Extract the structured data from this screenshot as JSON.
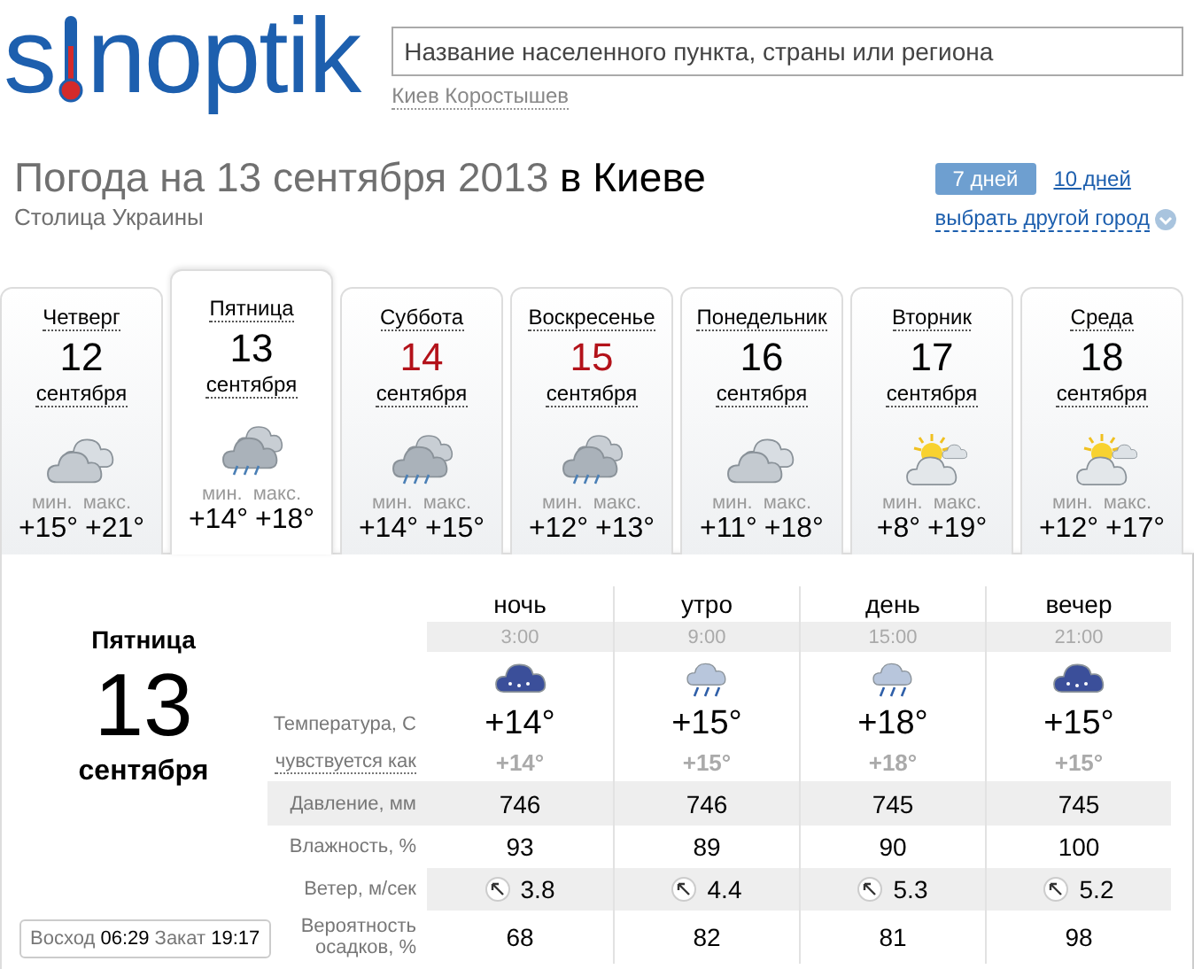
{
  "logo": {
    "part1": "s",
    "part2": "noptik"
  },
  "search": {
    "placeholder": "Название населенного пункта, страны или региона"
  },
  "suggestion": "Киев Коростышев",
  "heading": {
    "date_part": "Погода на 13 сентября 2013",
    "city_part": "в Киеве",
    "subtitle": "Столица Украины"
  },
  "range_tabs": [
    {
      "label": "7 дней",
      "selected": true
    },
    {
      "label": "10 дней",
      "selected": false
    }
  ],
  "choose_city": "выбрать другой город",
  "days": [
    {
      "weekday": "Четверг",
      "date": "12",
      "month": "сентября",
      "weekend": false,
      "selected": false,
      "kind": "cloudy",
      "min_label": "мин.",
      "max_label": "макс.",
      "min": "+15°",
      "max": "+21°"
    },
    {
      "weekday": "Пятница",
      "date": "13",
      "month": "сентября",
      "weekend": false,
      "selected": true,
      "kind": "rain",
      "min_label": "мин.",
      "max_label": "макс.",
      "min": "+14°",
      "max": "+18°"
    },
    {
      "weekday": "Суббота",
      "date": "14",
      "month": "сентября",
      "weekend": true,
      "selected": false,
      "kind": "rain",
      "min_label": "мин.",
      "max_label": "макс.",
      "min": "+14°",
      "max": "+15°"
    },
    {
      "weekday": "Воскресенье",
      "date": "15",
      "month": "сентября",
      "weekend": true,
      "selected": false,
      "kind": "rain",
      "min_label": "мин.",
      "max_label": "макс.",
      "min": "+12°",
      "max": "+13°"
    },
    {
      "weekday": "Понедельник",
      "date": "16",
      "month": "сентября",
      "weekend": false,
      "selected": false,
      "kind": "cloudy",
      "min_label": "мин.",
      "max_label": "макс.",
      "min": "+11°",
      "max": "+18°"
    },
    {
      "weekday": "Вторник",
      "date": "17",
      "month": "сентября",
      "weekend": false,
      "selected": false,
      "kind": "partly-sunny",
      "min_label": "мин.",
      "max_label": "макс.",
      "min": "+8°",
      "max": "+19°"
    },
    {
      "weekday": "Среда",
      "date": "18",
      "month": "сентября",
      "weekend": false,
      "selected": false,
      "kind": "partly-sunny",
      "min_label": "мин.",
      "max_label": "макс.",
      "min": "+12°",
      "max": "+17°"
    }
  ],
  "detail": {
    "weekday": "Пятница",
    "date": "13",
    "month": "сентября",
    "sunrise_label": "Восход",
    "sunrise": "06:29",
    "sunset_label": "Закат",
    "sunset": "19:17",
    "row_labels": {
      "temperature": "Температура, С",
      "feels": "чувствуется как",
      "pressure": "Давление, мм",
      "humidity": "Влажность, %",
      "wind": "Ветер, м/сек",
      "precip": "Вероятность осадков, %"
    },
    "periods": [
      {
        "name": "ночь",
        "time": "3:00",
        "kind": "heavy-rain",
        "temp": "+14°",
        "feels": "+14°",
        "pressure": "746",
        "humidity": "93",
        "wind": "3.8",
        "precip": "68"
      },
      {
        "name": "утро",
        "time": "9:00",
        "kind": "light-rain",
        "temp": "+15°",
        "feels": "+15°",
        "pressure": "746",
        "humidity": "89",
        "wind": "4.4",
        "precip": "82"
      },
      {
        "name": "день",
        "time": "15:00",
        "kind": "light-rain",
        "temp": "+18°",
        "feels": "+18°",
        "pressure": "745",
        "humidity": "90",
        "wind": "5.3",
        "precip": "81"
      },
      {
        "name": "вечер",
        "time": "21:00",
        "kind": "heavy-rain",
        "temp": "+15°",
        "feels": "+15°",
        "pressure": "745",
        "humidity": "100",
        "wind": "5.2",
        "precip": "98"
      }
    ]
  }
}
